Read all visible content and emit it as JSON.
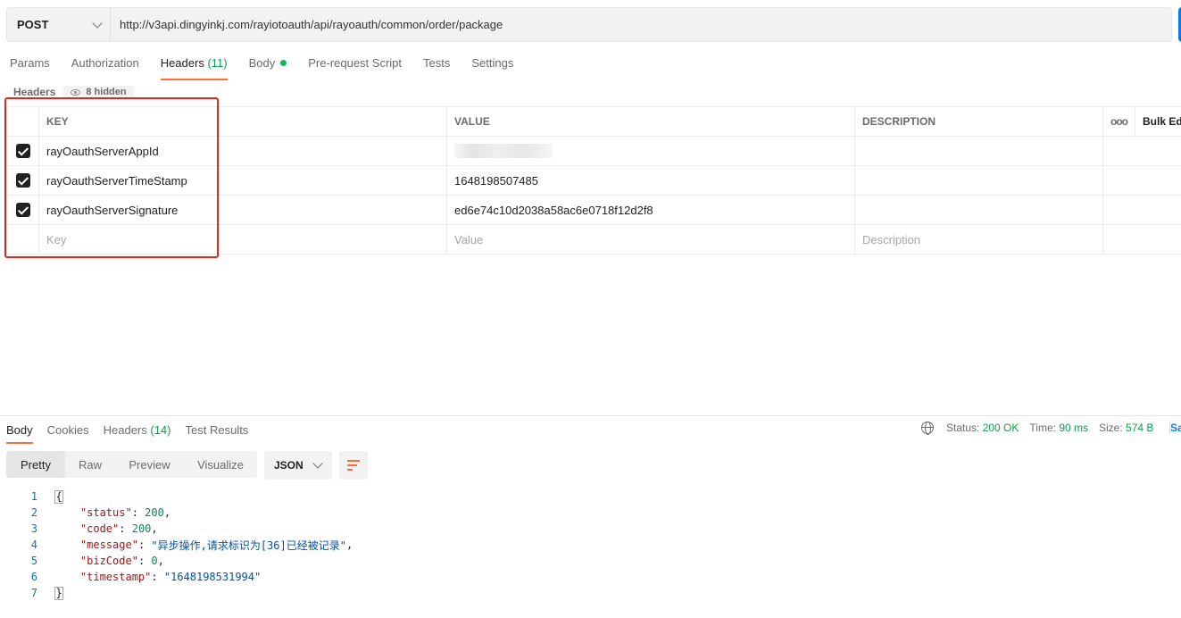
{
  "request": {
    "method": "POST",
    "url": "http://v3api.dingyinkj.com/rayiotoauth/api/rayoauth/common/order/package"
  },
  "request_tabs": [
    {
      "label": "Params"
    },
    {
      "label": "Authorization"
    },
    {
      "label": "Headers",
      "count": "(11)"
    },
    {
      "label": "Body"
    },
    {
      "label": "Pre-request Script"
    },
    {
      "label": "Tests"
    },
    {
      "label": "Settings"
    }
  ],
  "headers_section": {
    "title": "Headers",
    "hidden_label": "8 hidden"
  },
  "table": {
    "columns": {
      "key": "KEY",
      "value": "VALUE",
      "description": "DESCRIPTION",
      "bulk_edit": "Bulk Edit"
    },
    "rows": [
      {
        "checked": true,
        "key": "rayOauthServerAppId",
        "value": "",
        "description": ""
      },
      {
        "checked": true,
        "key": "rayOauthServerTimeStamp",
        "value": "1648198507485",
        "description": ""
      },
      {
        "checked": true,
        "key": "rayOauthServerSignature",
        "value": "ed6e74c10d2038a58ac6e0718f12d2f8",
        "description": ""
      }
    ],
    "placeholders": {
      "key": "Key",
      "value": "Value",
      "description": "Description"
    },
    "more_icon": "ooo"
  },
  "response": {
    "tabs": [
      {
        "label": "Body"
      },
      {
        "label": "Cookies"
      },
      {
        "label": "Headers",
        "count": "(14)"
      },
      {
        "label": "Test Results"
      }
    ],
    "status_label": "Status:",
    "status_value": "200 OK",
    "time_label": "Time:",
    "time_value": "90 ms",
    "size_label": "Size:",
    "size_value": "574 B",
    "save_label": "Sa",
    "view_modes": [
      "Pretty",
      "Raw",
      "Preview",
      "Visualize"
    ],
    "format": "JSON",
    "line_numbers": [
      "1",
      "2",
      "3",
      "4",
      "5",
      "6",
      "7"
    ],
    "json": {
      "open": "{",
      "close": "}",
      "status_key": "\"status\"",
      "status_val": "200",
      "code_key": "\"code\"",
      "code_val": "200",
      "message_key": "\"message\"",
      "message_val": "\"异步操作,请求标识为[36]已经被记录\"",
      "bizCode_key": "\"bizCode\"",
      "bizCode_val": "0",
      "timestamp_key": "\"timestamp\"",
      "timestamp_val": "\"1648198531994\""
    }
  },
  "colors": {
    "accent": "#ff6c37",
    "status_green": "#0d9f4f",
    "highlight_box": "#e0261d"
  }
}
